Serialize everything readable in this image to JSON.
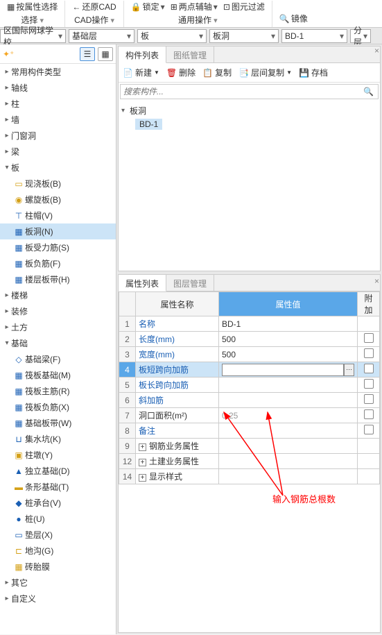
{
  "ribbon": {
    "groups": [
      {
        "label": "选择",
        "items": [
          {
            "icon": "▦",
            "text": "按属性选择"
          }
        ]
      },
      {
        "label": "CAD操作",
        "items": [
          {
            "icon": "←",
            "text": "还原CAD"
          }
        ]
      },
      {
        "label": "通用操作",
        "items": [
          {
            "icon": "🔒",
            "text": "锁定"
          },
          {
            "icon": "⊞",
            "text": "两点辅轴"
          },
          {
            "icon": "⊡",
            "text": "图元过滤"
          }
        ]
      },
      {
        "label": "",
        "items": [
          {
            "icon": "🔍",
            "text": "镜像"
          }
        ]
      }
    ]
  },
  "dropbar": [
    {
      "text": "区国际网球学校",
      "w": 95
    },
    {
      "text": "基础层",
      "w": 95
    },
    {
      "text": "板",
      "w": 100
    },
    {
      "text": "板洞",
      "w": 100
    },
    {
      "text": "BD-1",
      "w": 95
    },
    {
      "text": "分层",
      "w": 30
    }
  ],
  "leftTree": [
    {
      "text": "常用构件类型",
      "icon": "",
      "exp": ""
    },
    {
      "text": "轴线",
      "icon": "",
      "exp": ""
    },
    {
      "text": "柱",
      "icon": "",
      "exp": ""
    },
    {
      "text": "墙",
      "icon": "",
      "exp": ""
    },
    {
      "text": "门窗洞",
      "icon": "",
      "exp": ""
    },
    {
      "text": "梁",
      "icon": "",
      "exp": ""
    },
    {
      "text": "板",
      "icon": "",
      "exp": "▾",
      "children": [
        {
          "text": "现浇板(B)",
          "icon": "▭",
          "color": "#d4a017"
        },
        {
          "text": "螺旋板(B)",
          "icon": "◉",
          "color": "#d4a017"
        },
        {
          "text": "柱帽(V)",
          "icon": "⊤",
          "color": "#1a5fb4"
        },
        {
          "text": "板洞(N)",
          "icon": "▦",
          "color": "#1a5fb4",
          "sel": true
        },
        {
          "text": "板受力筋(S)",
          "icon": "▦",
          "color": "#1a5fb4"
        },
        {
          "text": "板负筋(F)",
          "icon": "▦",
          "color": "#1a5fb4"
        },
        {
          "text": "楼层板带(H)",
          "icon": "▦",
          "color": "#1a5fb4"
        }
      ]
    },
    {
      "text": "楼梯",
      "icon": "",
      "exp": ""
    },
    {
      "text": "装修",
      "icon": "",
      "exp": ""
    },
    {
      "text": "土方",
      "icon": "",
      "exp": ""
    },
    {
      "text": "基础",
      "icon": "",
      "exp": "▾",
      "children": [
        {
          "text": "基础梁(F)",
          "icon": "◇",
          "color": "#1a5fb4"
        },
        {
          "text": "筏板基础(M)",
          "icon": "▦",
          "color": "#1a5fb4"
        },
        {
          "text": "筏板主筋(R)",
          "icon": "▦",
          "color": "#1a5fb4"
        },
        {
          "text": "筏板负筋(X)",
          "icon": "▦",
          "color": "#1a5fb4"
        },
        {
          "text": "基础板带(W)",
          "icon": "▦",
          "color": "#1a5fb4"
        },
        {
          "text": "集水坑(K)",
          "icon": "⊔",
          "color": "#1a5fb4"
        },
        {
          "text": "柱墩(Y)",
          "icon": "▣",
          "color": "#d4a017"
        },
        {
          "text": "独立基础(D)",
          "icon": "▲",
          "color": "#1a5fb4"
        },
        {
          "text": "条形基础(T)",
          "icon": "▬",
          "color": "#d4a017"
        },
        {
          "text": "桩承台(V)",
          "icon": "◆",
          "color": "#1a5fb4"
        },
        {
          "text": "桩(U)",
          "icon": "●",
          "color": "#1a5fb4"
        },
        {
          "text": "垫层(X)",
          "icon": "▭",
          "color": "#1a5fb4"
        },
        {
          "text": "地沟(G)",
          "icon": "⊏",
          "color": "#d4a017"
        },
        {
          "text": "砖胎膜",
          "icon": "▦",
          "color": "#d4a017"
        }
      ]
    },
    {
      "text": "其它",
      "icon": "",
      "exp": ""
    },
    {
      "text": "自定义",
      "icon": "",
      "exp": ""
    }
  ],
  "topPanel": {
    "tabs": [
      "构件列表",
      "图纸管理"
    ],
    "toolbar": [
      {
        "icon": "📄",
        "text": "新建",
        "drop": true
      },
      {
        "icon": "🗑",
        "text": "删除",
        "color": "#c00"
      },
      {
        "icon": "📋",
        "text": "复制"
      },
      {
        "icon": "📑",
        "text": "层间复制",
        "drop": true
      },
      {
        "icon": "💾",
        "text": "存档"
      }
    ],
    "searchPlaceholder": "搜索构件...",
    "tree": [
      {
        "text": "板洞",
        "exp": "▾",
        "children": [
          {
            "text": "BD-1"
          }
        ]
      }
    ]
  },
  "botPanel": {
    "tabs": [
      "属性列表",
      "图层管理"
    ],
    "headers": {
      "name": "属性名称",
      "value": "属性值",
      "extra": "附加"
    },
    "rows": [
      {
        "n": "1",
        "name": "名称",
        "val": "BD-1",
        "blue": true
      },
      {
        "n": "2",
        "name": "长度(mm)",
        "val": "500",
        "blue": true,
        "chk": true
      },
      {
        "n": "3",
        "name": "宽度(mm)",
        "val": "500",
        "blue": true,
        "chk": true
      },
      {
        "n": "4",
        "name": "板短跨向加筋",
        "val": "",
        "blue": true,
        "chk": true,
        "sel": true,
        "ellipsis": true
      },
      {
        "n": "5",
        "name": "板长跨向加筋",
        "val": "",
        "blue": true,
        "chk": true
      },
      {
        "n": "6",
        "name": "斜加筋",
        "val": "",
        "blue": true,
        "chk": true
      },
      {
        "n": "7",
        "name": "洞口面积(m²)",
        "val": "0.25",
        "blue": false,
        "chk": true,
        "grey": true
      },
      {
        "n": "8",
        "name": "备注",
        "val": "",
        "blue": true,
        "chk": true
      },
      {
        "n": "9",
        "name": "钢筋业务属性",
        "val": "",
        "expand": true
      },
      {
        "n": "12",
        "name": "土建业务属性",
        "val": "",
        "expand": true
      },
      {
        "n": "14",
        "name": "显示样式",
        "val": "",
        "expand": true
      }
    ]
  },
  "annotation": "输入钢筋总根数"
}
